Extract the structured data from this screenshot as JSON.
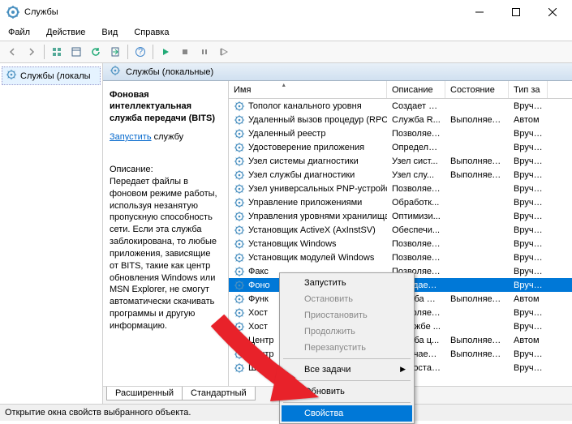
{
  "window": {
    "title": "Службы"
  },
  "menu": {
    "file": "Файл",
    "action": "Действие",
    "view": "Вид",
    "help": "Справка"
  },
  "tree": {
    "root": "Службы (локалы"
  },
  "tabheader": {
    "title": "Службы (локальные)"
  },
  "selected_service": {
    "title": "Фоновая интеллектуальная служба передачи (BITS)",
    "start_link_prefix": "Запустить",
    "start_link_suffix": " службу",
    "desc_label": "Описание:",
    "desc_text": "Передает файлы в фоновом режиме работы, используя незанятую пропускную способность сети. Если эта служба заблокирована, то любые приложения, зависящие от BITS, такие как центр обновления Windows или MSN Explorer, не смогут автоматически скачивать программы и другую информацию."
  },
  "columns": {
    "name": "Имя",
    "desc": "Описание",
    "state": "Состояние",
    "type": "Тип за"
  },
  "rows": [
    {
      "name": "Тополог канального уровня",
      "desc": "Создает ка...",
      "state": "",
      "type": "Вручну"
    },
    {
      "name": "Удаленный вызов процедур (RPC)",
      "desc": "Служба R...",
      "state": "Выполняется",
      "type": "Автом"
    },
    {
      "name": "Удаленный реестр",
      "desc": "Позволяет...",
      "state": "",
      "type": "Вручну"
    },
    {
      "name": "Удостоверение приложения",
      "desc": "Определяе...",
      "state": "",
      "type": "Вручну"
    },
    {
      "name": "Узел системы диагностики",
      "desc": "Узел сист...",
      "state": "Выполняется",
      "type": "Вручну"
    },
    {
      "name": "Узел службы диагностики",
      "desc": "Узел слу...",
      "state": "Выполняется",
      "type": "Вручну"
    },
    {
      "name": "Узел универсальных PNP-устройств",
      "desc": "Позволяет...",
      "state": "",
      "type": "Вручну"
    },
    {
      "name": "Управление приложениями",
      "desc": "Обработк...",
      "state": "",
      "type": "Вручну"
    },
    {
      "name": "Управления уровнями хранилища",
      "desc": "Оптимизи...",
      "state": "",
      "type": "Вручну"
    },
    {
      "name": "Установщик ActiveX (AxInstSV)",
      "desc": "Обеспечи...",
      "state": "",
      "type": "Вручну"
    },
    {
      "name": "Установщик Windows",
      "desc": "Позволяет...",
      "state": "",
      "type": "Вручну"
    },
    {
      "name": "Установщик модулей Windows",
      "desc": "Позволяет...",
      "state": "",
      "type": "Вручну"
    },
    {
      "name": "Факс",
      "desc": "Позволяет...",
      "state": "",
      "type": "Вручну"
    },
    {
      "name": "Фоно",
      "desc": "Передает ...",
      "state": "",
      "type": "Вручну",
      "sel": true
    },
    {
      "name": "Функ",
      "desc": "Служба ф...",
      "state": "Выполняется",
      "type": "Автом"
    },
    {
      "name": "Хост ",
      "desc": "Позволяет...",
      "state": "",
      "type": "Вручну"
    },
    {
      "name": "Хост ",
      "desc": "В службе ...",
      "state": "",
      "type": "Вручну"
    },
    {
      "name": "Центр",
      "desc": "Служба ц...",
      "state": "Выполняется",
      "type": "Автом"
    },
    {
      "name": "Центр",
      "desc": "Включает ...",
      "state": "Выполняется",
      "type": "Вручну"
    },
    {
      "name": "Шифр",
      "desc": "Предостав...",
      "state": "",
      "type": "Вручну"
    }
  ],
  "bottom_tabs": {
    "ext": "Расширенный",
    "std": "Стандартный"
  },
  "statusbar": "Открытие окна свойств выбранного объекта.",
  "context_menu": {
    "start": "Запустить",
    "stop": "Остановить",
    "pause": "Приостановить",
    "resume": "Продолжить",
    "restart": "Перезапустить",
    "all_tasks": "Все задачи",
    "refresh": "Обновить",
    "properties": "Свойства"
  }
}
